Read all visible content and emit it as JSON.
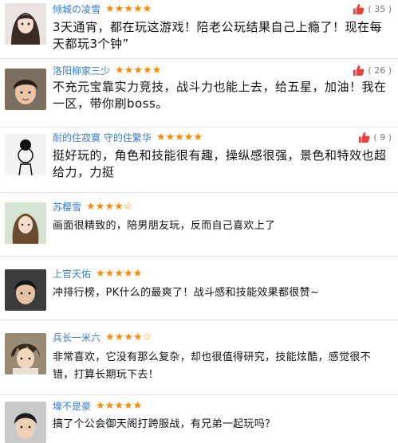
{
  "reviews": [
    {
      "username": "倾城の凌雪",
      "stars": "★★★★★",
      "likes": "( 35 )",
      "text": "3天通宵，都在玩这游戏！陪老公玩结果自己上瘾了！现在每天都玩3个钟”"
    },
    {
      "username": "洛阳柳家三少",
      "stars": "★★★★★",
      "likes": "( 26 )",
      "text": "不充元宝靠实力竞技，战斗力也能上去，给五星，加油！我在一区，带你刷boss。"
    },
    {
      "username": "耐的住寂寞 守的住繁华",
      "stars": "★★★★★",
      "likes": "( 9 )",
      "text": "挺好玩的，角色和技能很有趣，操纵感很强，景色和特效也超给力，力挺"
    },
    {
      "username": "苏樱雪",
      "stars": "★★★★☆",
      "text": "画面很精致的，陪男朋友玩，反而自己喜欢上了"
    },
    {
      "username": "上官天佑",
      "stars": "★★★★★",
      "text": "冲排行榜，PK什么的最爽了！战斗感和技能效果都很赞~"
    },
    {
      "username": "兵长一米六",
      "stars": "★★★★☆",
      "text": "非常喜欢，它没有那么复杂，却也很值得研究，技能炫酷，感觉很不错，打算长期玩下去！"
    },
    {
      "username": "壕不是豪",
      "stars": "★★★★★",
      "text": "搞了个公会御天阁打跨服战，有兄弟一起玩吗？"
    }
  ],
  "colors": {
    "username": "#3a7bc8",
    "stars": "#ff8a00",
    "thumb": "#e8413a"
  },
  "icons": {
    "like": "thumbs-up-icon"
  }
}
